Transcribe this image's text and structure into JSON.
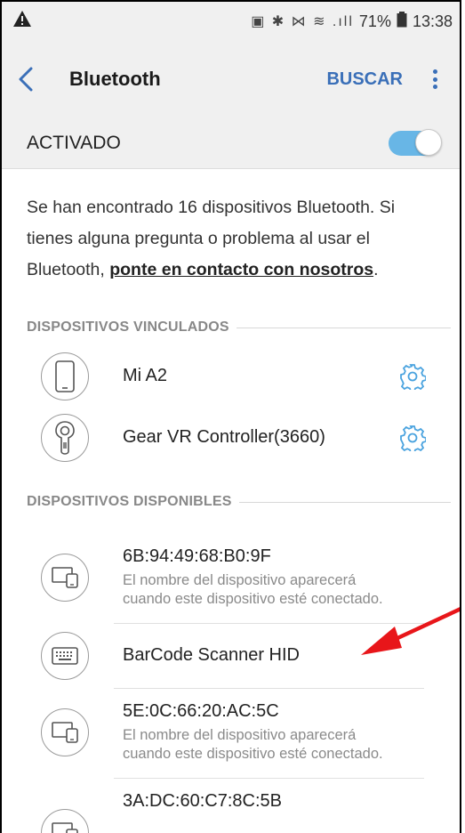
{
  "status": {
    "left_icon": "warning-triangle-icon",
    "icons": "▣ ✱ ⋈ ≋ .ıll",
    "battery": "71%",
    "time": "13:38"
  },
  "appbar": {
    "title": "Bluetooth",
    "search_label": "BUSCAR"
  },
  "toggle": {
    "label": "ACTIVADO",
    "on": true,
    "accent": "#68b6e6"
  },
  "info": {
    "text": "Se han encontrado 16 dispositivos Bluetooth. Si tienes alguna pregunta o problema al usar el Bluetooth, ",
    "link": "ponte en contacto con nosotros",
    "end": "."
  },
  "paired": {
    "header": "DISPOSITIVOS VINCULADOS",
    "devices": [
      {
        "name": "Mi A2",
        "icon": "phone-icon"
      },
      {
        "name": "Gear VR Controller(3660)",
        "icon": "vr-controller-icon"
      }
    ]
  },
  "available": {
    "header": "DISPOSITIVOS DISPONIBLES",
    "devices": [
      {
        "name": "6B:94:49:68:B0:9F",
        "sub1": "El nombre del dispositivo aparecerá",
        "sub2": "cuando este dispositivo esté conectado.",
        "icon": "devices-icon"
      },
      {
        "name": "BarCode Scanner HID",
        "icon": "keyboard-icon"
      },
      {
        "name": "5E:0C:66:20:AC:5C",
        "sub1": "El nombre del dispositivo aparecerá",
        "sub2": "cuando este dispositivo esté conectado.",
        "icon": "devices-icon"
      },
      {
        "name": "3A:DC:60:C7:8C:5B",
        "icon": "devices-icon"
      }
    ]
  },
  "colors": {
    "accent_blue": "#3a6fb8",
    "gear_blue": "#4aa3df",
    "annotation_red": "#e8161a"
  }
}
